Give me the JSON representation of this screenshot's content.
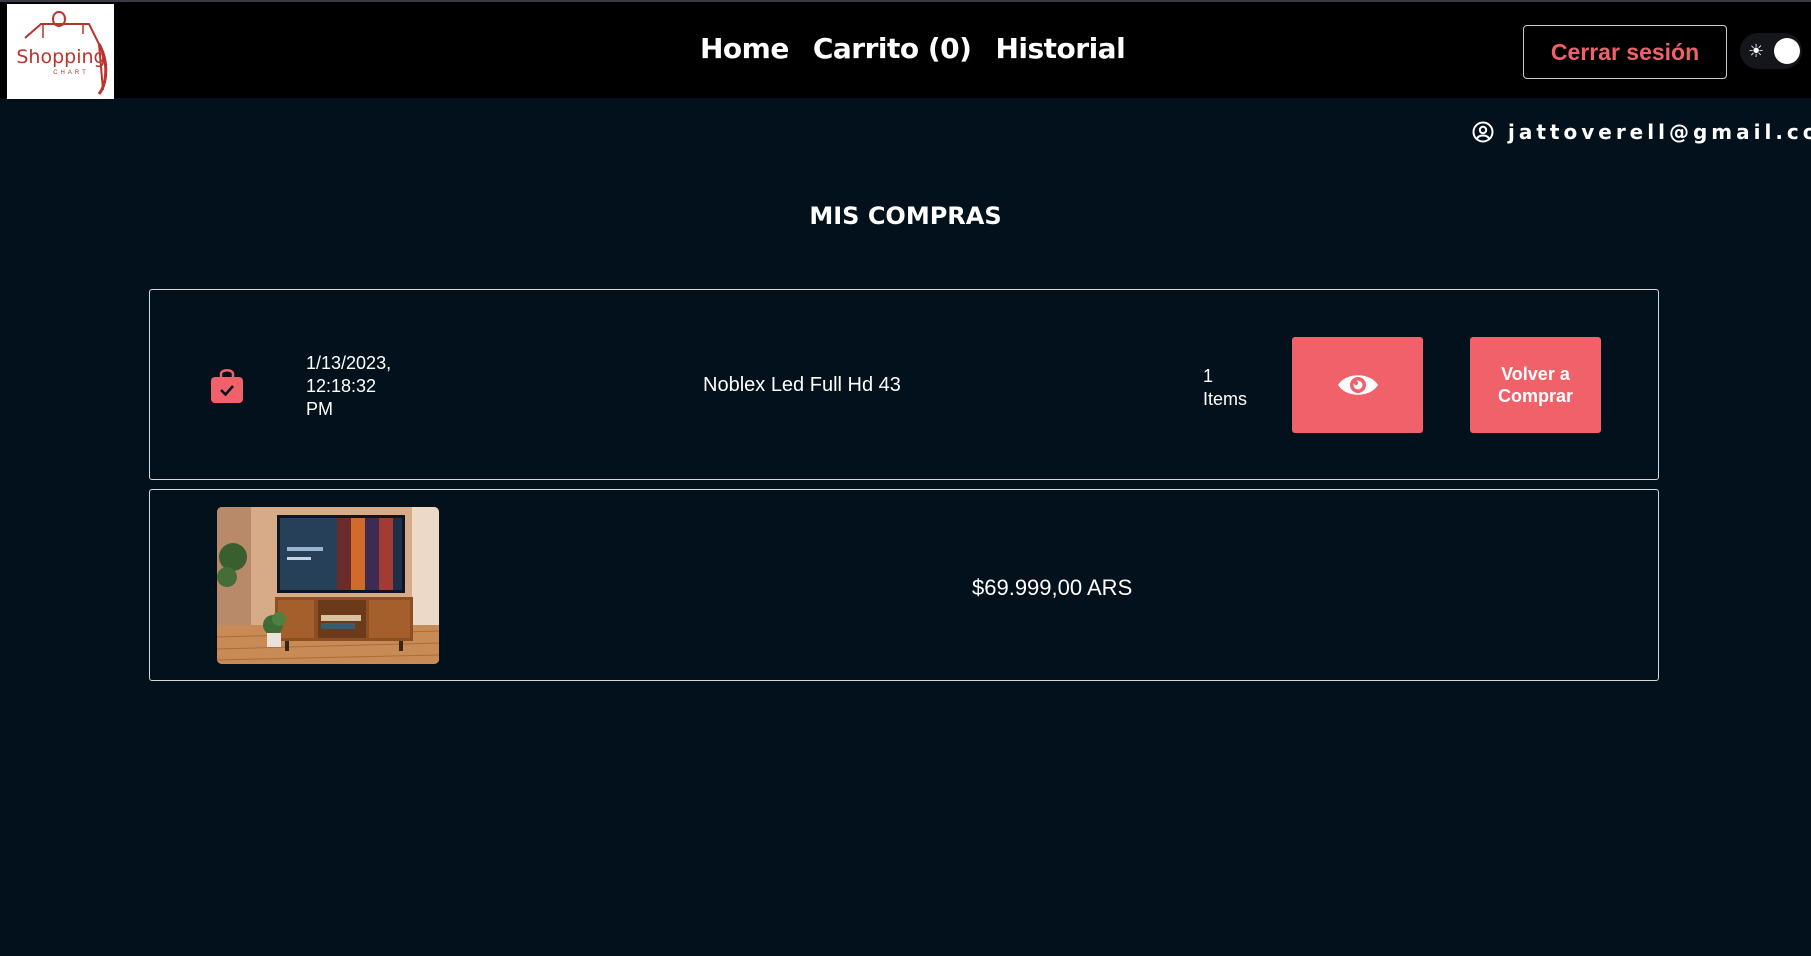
{
  "header": {
    "logo": {
      "text": "Shopping",
      "subtext": "CHART"
    },
    "nav": [
      {
        "label": "Home"
      },
      {
        "label": "Carrito (0)"
      },
      {
        "label": "Historial"
      }
    ],
    "logout_label": "Cerrar sesión",
    "theme_toggle": {
      "icon": "sun-icon",
      "state": "dark"
    }
  },
  "user": {
    "email": "jattoverell@gmail.com",
    "icon": "user-circle-icon"
  },
  "page_title": "MIS COMPRAS",
  "purchase": {
    "date_line1": "1/13/2023,",
    "date_line2": "12:18:32",
    "date_line3": "PM",
    "product_name": "Noblex Led Full Hd 43",
    "items_count": "1",
    "items_label": "Items",
    "view_icon": "eye-icon",
    "rebuy_line1": "Volver a",
    "rebuy_line2": "Comprar",
    "detail": {
      "price": "$69.999,00 ARS",
      "image": "tv-on-wooden-console-photo"
    }
  },
  "colors": {
    "accent": "#f0616a",
    "background": "#02111b",
    "header": "#000000",
    "logo_red": "#b8342c"
  }
}
